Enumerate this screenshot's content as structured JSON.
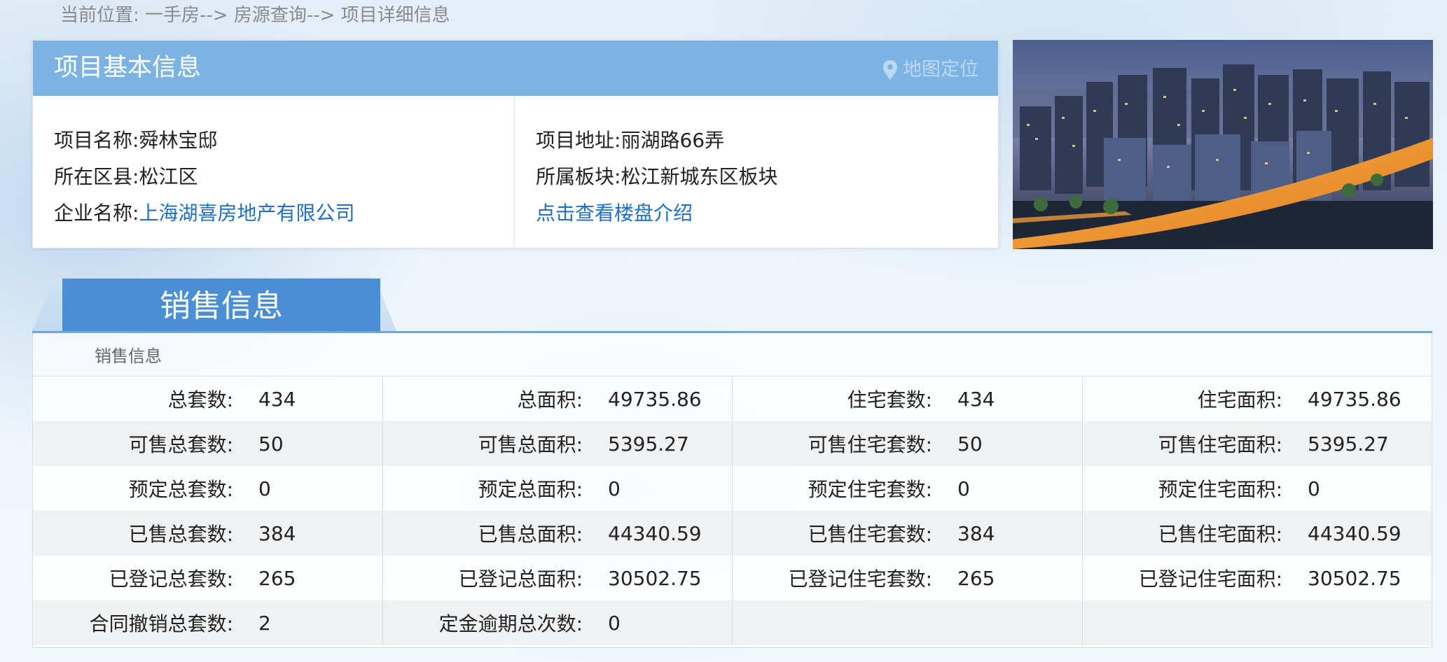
{
  "breadcrumb": {
    "prefix": "当前位置:",
    "path": "一手房--> 房源查询--> 项目详细信息"
  },
  "project_info": {
    "title": "项目基本信息",
    "map_link": "地图定位",
    "left": [
      {
        "label": "项目名称:",
        "value": "舜林宝邸"
      },
      {
        "label": "所在区县:",
        "value": "松江区"
      },
      {
        "label": "企业名称:",
        "value": "上海湖喜房地产有限公司"
      }
    ],
    "right": [
      {
        "label": "项目地址:",
        "value": "丽湖路66弄"
      },
      {
        "label": "所属板块:",
        "value": "松江新城东区板块"
      }
    ],
    "intro_link": "点击查看楼盘介绍"
  },
  "sales": {
    "tab_label": "销售信息",
    "subtitle": "销售信息",
    "rows": [
      [
        [
          "总套数:",
          "434"
        ],
        [
          "总面积:",
          "49735.86"
        ],
        [
          "住宅套数:",
          "434"
        ],
        [
          "住宅面积:",
          "49735.86"
        ]
      ],
      [
        [
          "可售总套数:",
          "50"
        ],
        [
          "可售总面积:",
          "5395.27"
        ],
        [
          "可售住宅套数:",
          "50"
        ],
        [
          "可售住宅面积:",
          "5395.27"
        ]
      ],
      [
        [
          "预定总套数:",
          "0"
        ],
        [
          "预定总面积:",
          "0"
        ],
        [
          "预定住宅套数:",
          "0"
        ],
        [
          "预定住宅面积:",
          "0"
        ]
      ],
      [
        [
          "已售总套数:",
          "384"
        ],
        [
          "已售总面积:",
          "44340.59"
        ],
        [
          "已售住宅套数:",
          "384"
        ],
        [
          "已售住宅面积:",
          "44340.59"
        ]
      ],
      [
        [
          "已登记总套数:",
          "265"
        ],
        [
          "已登记总面积:",
          "30502.75"
        ],
        [
          "已登记住宅套数:",
          "265"
        ],
        [
          "已登记住宅面积:",
          "30502.75"
        ]
      ],
      [
        [
          "合同撤销总套数:",
          "2"
        ],
        [
          "定金逾期总次数:",
          "0"
        ],
        [
          "",
          ""
        ],
        [
          "",
          ""
        ]
      ]
    ]
  },
  "colors": {
    "header_blue": "#7db3e3",
    "tab_blue": "#4a8fd6",
    "link_blue": "#1e6fc9"
  },
  "icons": {
    "map": "map-pin-icon"
  }
}
